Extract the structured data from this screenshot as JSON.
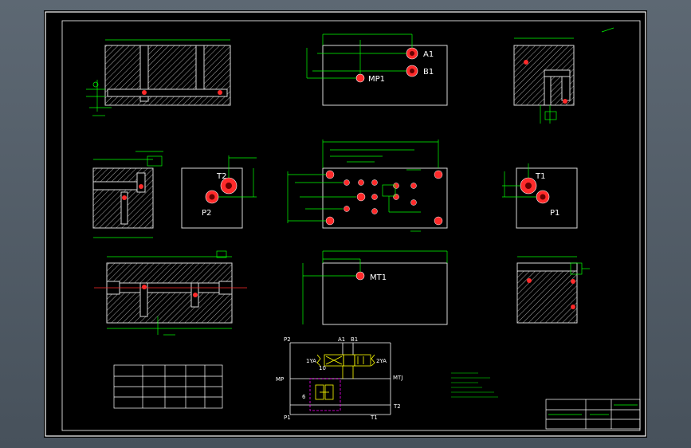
{
  "colors": {
    "background": "#4f5963",
    "sheet": "#000000",
    "part": "#d8d8d8",
    "dimension": "#00ff00",
    "hole": "#ff2a2a",
    "text": "#ffffff",
    "hydraulic": "#ffff00",
    "valve_box": "#ff00ff"
  },
  "ports": {
    "a1": "A1",
    "b1": "B1",
    "mp1": "MP1",
    "t2": "T2",
    "p2": "P2",
    "t1": "T1",
    "p1": "P1",
    "mt1": "MT1"
  },
  "hydraulic": {
    "p2": "P2",
    "a1": "A1",
    "b1": "B1",
    "sol_left": "1YA",
    "sol_right": "2YA",
    "valve_code": "10",
    "mp": "MP",
    "mt": "MTJ",
    "p1": "P1",
    "t1": "T1",
    "t2": "T2",
    "item6": "6"
  }
}
